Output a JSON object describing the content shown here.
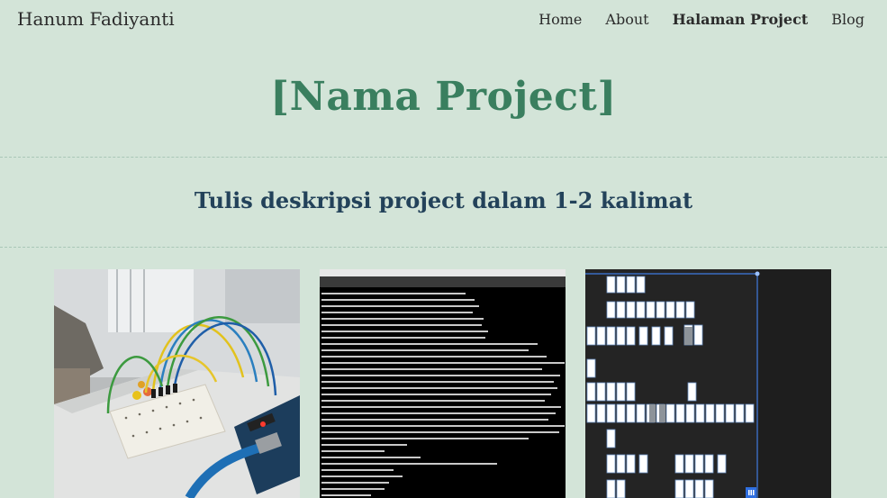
{
  "nav": {
    "brand": "Hanum Fadiyanti",
    "links": [
      {
        "label": "Home",
        "active": false
      },
      {
        "label": "About",
        "active": false
      },
      {
        "label": "Halaman Project",
        "active": true
      },
      {
        "label": "Blog",
        "active": false
      }
    ]
  },
  "hero": {
    "title": "[Nama Project]"
  },
  "description": {
    "text": "Tulis deskripsi project dalam 1-2 kalimat"
  },
  "gallery": {
    "images": [
      {
        "name": "breadboard-circuit-photo",
        "description": "Photo of an Arduino board wired to a breadboard with LEDs"
      },
      {
        "name": "terminal-screenshot",
        "description": "Terminal window showing package update output"
      },
      {
        "name": "flowchart-diagram-screenshot",
        "description": "Dark canvas with a flowchart diagram of boxes"
      }
    ]
  },
  "colors": {
    "background": "#d3e4d8",
    "title": "#3a7f5f",
    "subtitle": "#23425a",
    "text": "#2b2b2b"
  }
}
